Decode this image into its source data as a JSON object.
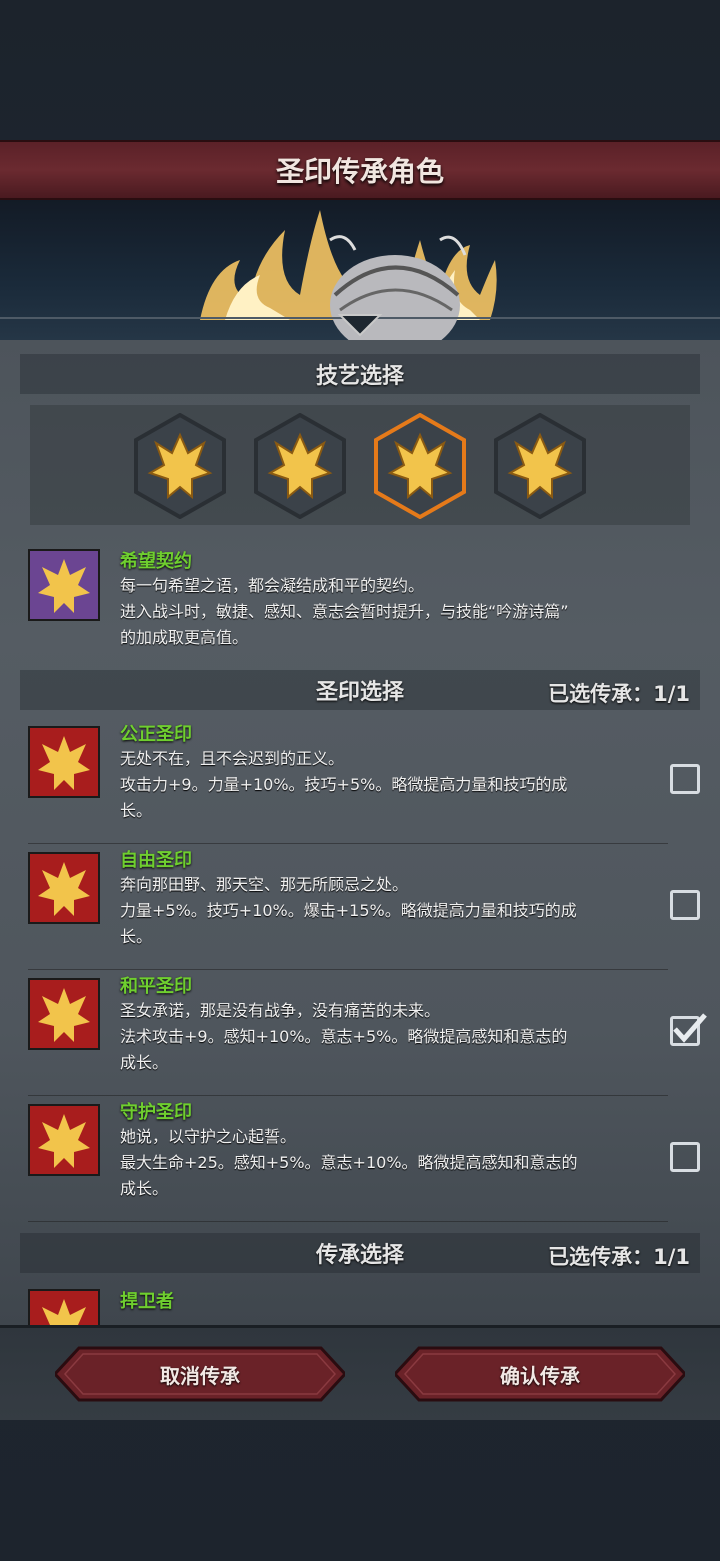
{
  "header": {
    "title": "圣印传承角色"
  },
  "skill_section": {
    "title": "技艺选择",
    "selected_index": 2,
    "icons": [
      "hope-emblem-icon",
      "hope-emblem-icon",
      "hope-emblem-icon",
      "hope-emblem-icon"
    ]
  },
  "skill": {
    "name": "希望契约",
    "lines": [
      "每一句希望之语，都会凝结成和平的契约。",
      "进入战斗时，敏捷、感知、意志会暂时提升，与技能“吟游诗篇”",
      "的加成取更高值。"
    ]
  },
  "seal_section": {
    "title": "圣印选择",
    "count": "已选传承：1/1"
  },
  "seals": [
    {
      "name": "公正圣印",
      "lines": [
        "无处不在，且不会迟到的正义。",
        "攻击力+9。力量+10%。技巧+5%。略微提高力量和技巧的成",
        "长。"
      ],
      "checked": false
    },
    {
      "name": "自由圣印",
      "lines": [
        "奔向那田野、那天空、那无所顾忌之处。",
        "力量+5%。技巧+10%。爆击+15%。略微提高力量和技巧的成",
        "长。"
      ],
      "checked": false
    },
    {
      "name": "和平圣印",
      "lines": [
        "圣女承诺，那是没有战争，没有痛苦的未来。",
        "法术攻击+9。感知+10%。意志+5%。略微提高感知和意志的",
        "成长。"
      ],
      "checked": true
    },
    {
      "name": "守护圣印",
      "lines": [
        "她说，以守护之心起誓。",
        "最大生命+25。感知+5%。意志+10%。略微提高感知和意志的",
        "成长。"
      ],
      "checked": false
    }
  ],
  "inherit_section": {
    "title": "传承选择",
    "count": "已选传承：1/1"
  },
  "inherit_items": [
    {
      "name": "捍卫者"
    }
  ],
  "footer": {
    "cancel_label": "取消传承",
    "confirm_label": "确认传承"
  },
  "colors": {
    "accent_green": "#6fcf2f",
    "selected_orange": "#e57a1a",
    "button_red": "#6a2228"
  }
}
